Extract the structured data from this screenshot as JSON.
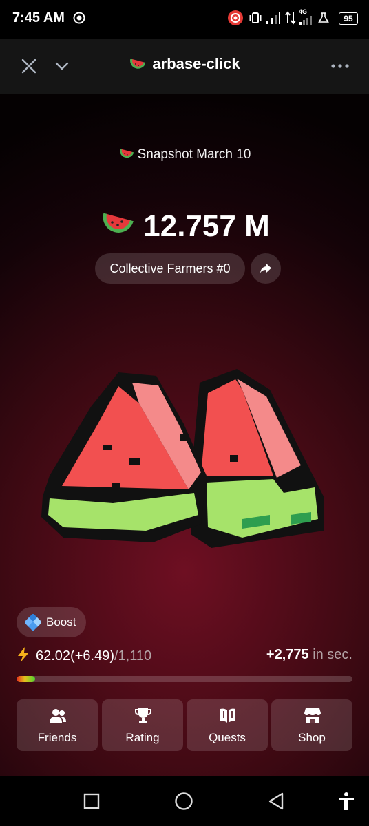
{
  "status_bar": {
    "time": "7:45 AM",
    "network": "4G",
    "battery": "95"
  },
  "header": {
    "title": "arbase-click",
    "icons": [
      "close-icon",
      "chevron-down-icon",
      "watermelon-icon",
      "more-icon"
    ]
  },
  "main": {
    "snapshot_label": "Snapshot March 10",
    "score": "12.757 M",
    "farmers_label": "Collective Farmers #0",
    "boost_label": "Boost",
    "energy": {
      "current": "62.02(+6.49)",
      "max": "/1,110",
      "per_sec_value": "+2,775",
      "per_sec_label": "in sec.",
      "fill_fraction": 0.056
    },
    "nav": [
      {
        "label": "Friends",
        "icon": "friends-icon"
      },
      {
        "label": "Rating",
        "icon": "trophy-icon"
      },
      {
        "label": "Quests",
        "icon": "book-icon"
      },
      {
        "label": "Shop",
        "icon": "shop-icon"
      }
    ]
  },
  "colors": {
    "bg_top": "#050102",
    "bg_center": "#6e0f22",
    "melon_red": "#f25a5a",
    "rind_green": "#a6e36a"
  }
}
